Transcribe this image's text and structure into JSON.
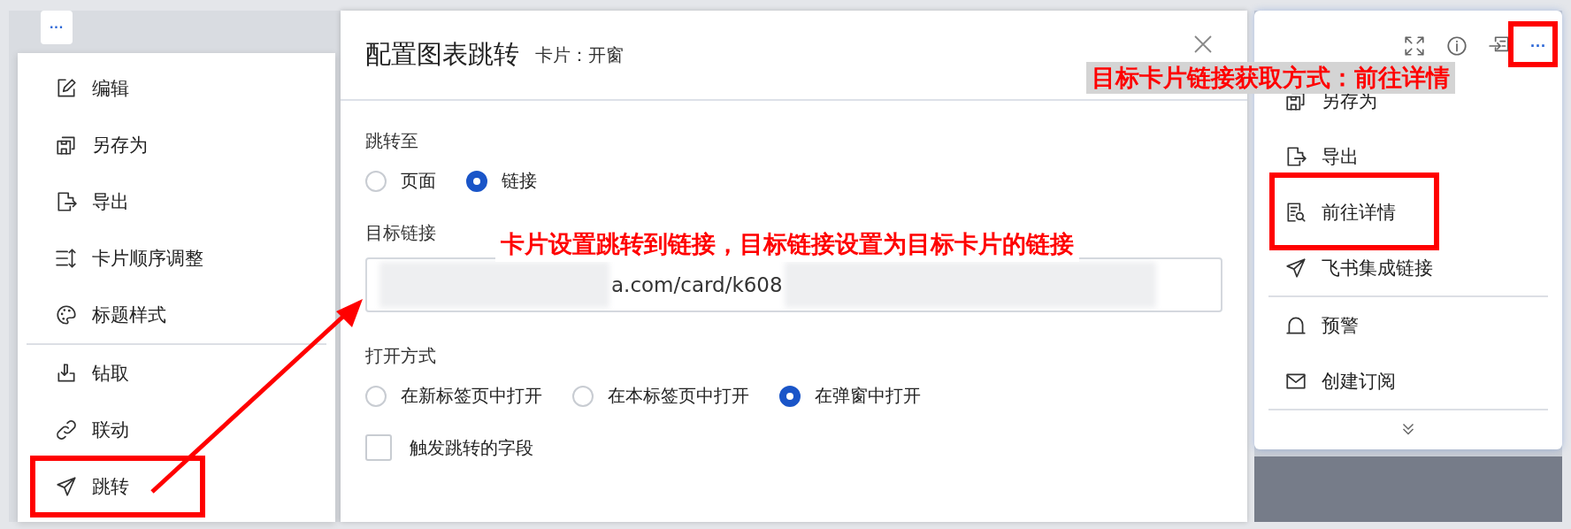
{
  "left_menu": {
    "more_button": "···",
    "groups": [
      [
        {
          "label": "编辑"
        },
        {
          "label": "另存为"
        },
        {
          "label": "导出"
        },
        {
          "label": "卡片顺序调整"
        },
        {
          "label": "标题样式"
        }
      ],
      [
        {
          "label": "钻取"
        },
        {
          "label": "联动"
        },
        {
          "label": "跳转"
        }
      ]
    ]
  },
  "dialog": {
    "title": "配置图表跳转",
    "subtitle": "卡片：开窗",
    "jump_to": {
      "label": "跳转至",
      "options": [
        {
          "label": "页面",
          "selected": false
        },
        {
          "label": "链接",
          "selected": true
        }
      ]
    },
    "target_link": {
      "label": "目标链接",
      "value": "a.com/card/k608"
    },
    "open_mode": {
      "label": "打开方式",
      "options": [
        {
          "label": "在新标签页中打开",
          "selected": false
        },
        {
          "label": "在本标签页中打开",
          "selected": false
        },
        {
          "label": "在弹窗中打开",
          "selected": true
        }
      ]
    },
    "trigger_field": {
      "label": "触发跳转的字段",
      "checked": false
    }
  },
  "right_menu": {
    "more_button": "···",
    "groups": [
      [
        {
          "label": "另存为"
        },
        {
          "label": "导出"
        },
        {
          "label": "前往详情"
        },
        {
          "label": "飞书集成链接"
        }
      ],
      [
        {
          "label": "预警"
        },
        {
          "label": "创建订阅"
        }
      ]
    ]
  },
  "annotations": [
    {
      "kind": "banner",
      "text": "目标卡片链接获取方式：前往详情"
    },
    {
      "kind": "note",
      "text": "卡片设置跳转到链接，目标链接设置为目标卡片的链接"
    }
  ]
}
